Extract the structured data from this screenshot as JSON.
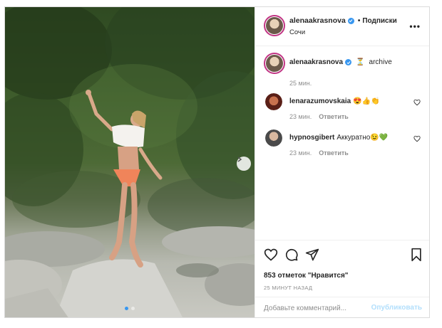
{
  "post": {
    "username": "alenaakrasnova",
    "follow_label": "Подписки",
    "location": "Сочи",
    "more_label": "•••"
  },
  "caption": {
    "username": "alenaakrasnova",
    "emoji": "⏳",
    "text": "archive",
    "time": "25 мин."
  },
  "comments": [
    {
      "username": "lenarazumovskaia",
      "text": "😍👍👏",
      "time": "23 мин.",
      "reply_label": "Ответить"
    },
    {
      "username": "hypnosgibert",
      "text": "Аккуратно😉💚",
      "time": "23 мин.",
      "reply_label": "Ответить"
    }
  ],
  "stats": {
    "likes": "853 отметок \"Нравится\"",
    "time_ago": "25 МИНУТ НАЗАД"
  },
  "comment_form": {
    "placeholder": "Добавьте комментарий...",
    "post_label": "Опубликовать"
  },
  "colors": {
    "accent": "#3897f0",
    "story_ring": "#c13584",
    "post_disabled": "#b2dffc"
  },
  "icons": {
    "like": "heart-icon",
    "comment": "comment-icon",
    "share": "share-icon",
    "save": "bookmark-icon",
    "next": "chevron-right-icon"
  },
  "carousel": {
    "current": 1,
    "total": 2
  }
}
